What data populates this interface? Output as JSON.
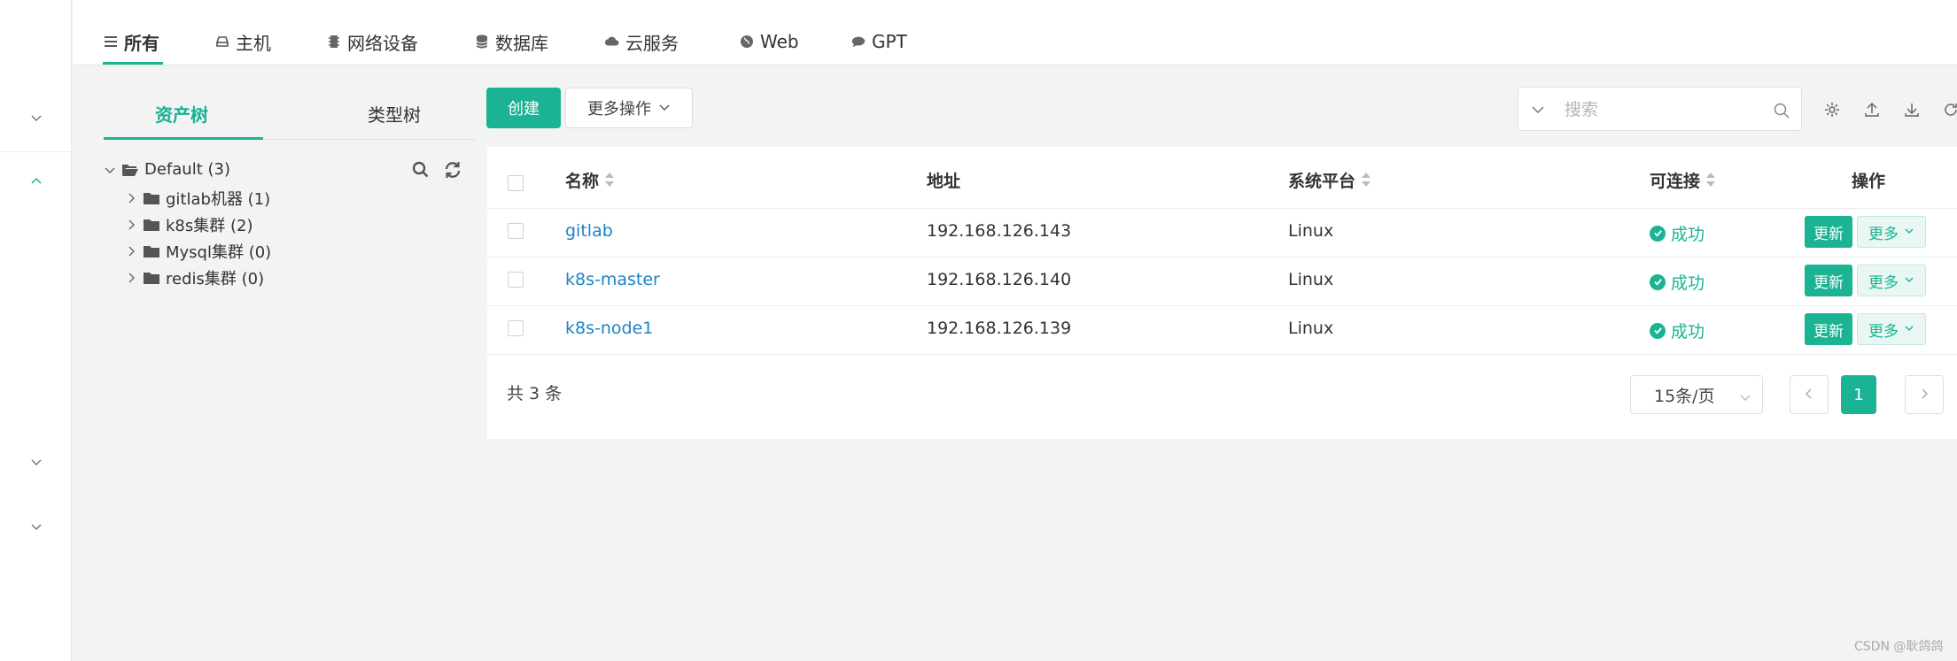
{
  "top_tabs": [
    {
      "label": "所有",
      "icon": "list-icon"
    },
    {
      "label": "主机",
      "icon": "host-icon"
    },
    {
      "label": "网络设备",
      "icon": "chip-icon"
    },
    {
      "label": "数据库",
      "icon": "database-icon"
    },
    {
      "label": "云服务",
      "icon": "cloud-icon"
    },
    {
      "label": "Web",
      "icon": "globe-icon"
    },
    {
      "label": "GPT",
      "icon": "chat-icon"
    }
  ],
  "tree": {
    "tabs": [
      "资产树",
      "类型树"
    ],
    "root": "Default (3)",
    "children": [
      "gitlab机器 (1)",
      "k8s集群 (2)",
      "Mysql集群 (0)",
      "redis集群 (0)"
    ]
  },
  "toolbar": {
    "create_label": "创建",
    "more_actions_label": "更多操作",
    "search_placeholder": "搜索"
  },
  "table": {
    "headers": [
      "名称",
      "地址",
      "系统平台",
      "可连接",
      "操作"
    ],
    "rows": [
      {
        "name": "gitlab",
        "address": "192.168.126.143",
        "platform": "Linux",
        "status": "成功"
      },
      {
        "name": "k8s-master",
        "address": "192.168.126.140",
        "platform": "Linux",
        "status": "成功"
      },
      {
        "name": "k8s-node1",
        "address": "192.168.126.139",
        "platform": "Linux",
        "status": "成功"
      }
    ],
    "update_label": "更新",
    "more_label": "更多"
  },
  "pagination": {
    "total_text": "共 3 条",
    "page_size": "15条/页",
    "current_page": "1"
  },
  "watermark": "CSDN @耿鸽鸽",
  "colors": {
    "accent": "#1ab394",
    "link": "#1c84c6"
  }
}
